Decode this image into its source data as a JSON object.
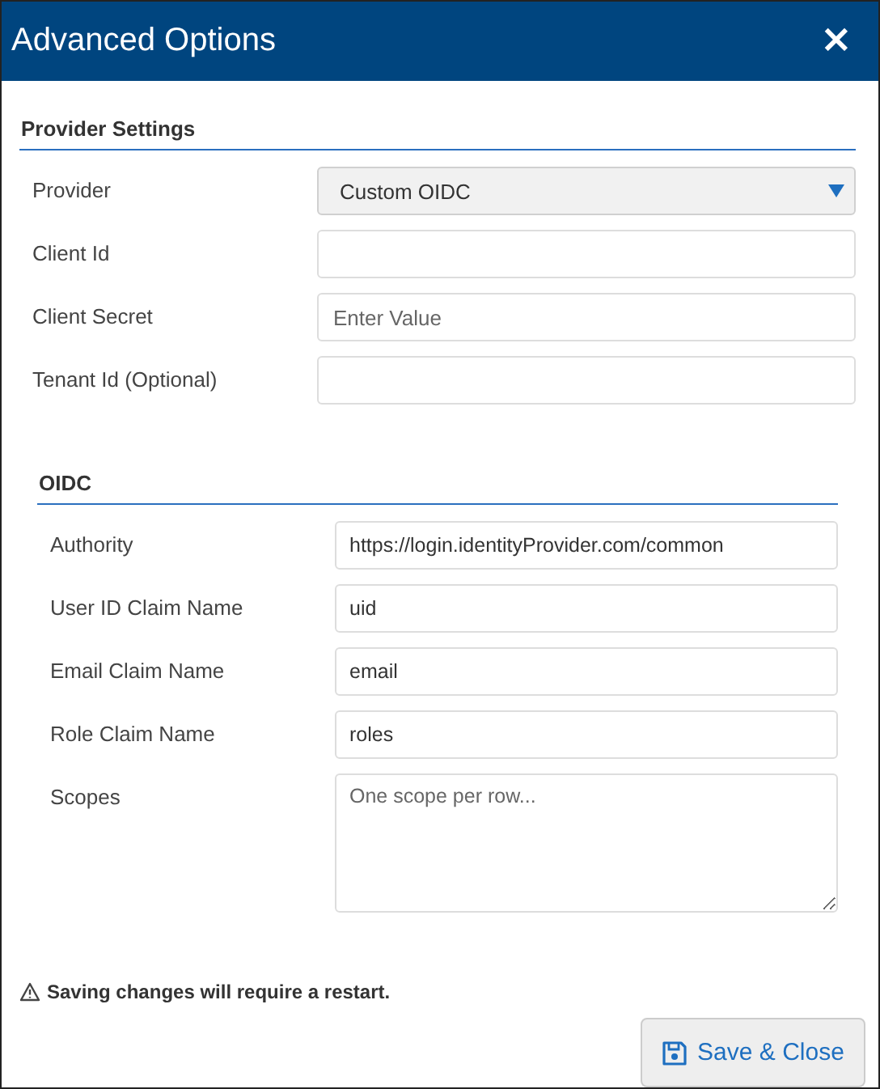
{
  "window": {
    "title": "Advanced Options",
    "close": "×"
  },
  "sections": [
    {
      "title": "Provider Settings",
      "fields": [
        {
          "label": "Provider",
          "kind": "select",
          "value": "Custom OIDC"
        },
        {
          "label": "Client Id",
          "kind": "text"
        },
        {
          "label": "Client Secret",
          "kind": "text",
          "placeholder": "Enter Value"
        },
        {
          "label": "Tenant Id (Optional)",
          "kind": "text"
        }
      ]
    },
    {
      "title": "OIDC",
      "fields": [
        {
          "label": "Authority",
          "kind": "text",
          "value": "https://login.identityProvider.com/common"
        },
        {
          "label": "User ID Claim Name",
          "kind": "text",
          "value": "uid"
        },
        {
          "label": "Email Claim Name",
          "kind": "text",
          "value": "email"
        },
        {
          "label": "Role Claim Name",
          "kind": "text",
          "value": "roles"
        },
        {
          "label": "Scopes",
          "kind": "textarea",
          "placeholder": "One scope per row..."
        }
      ]
    }
  ],
  "warning": "Saving changes will require a restart.",
  "buttons": [
    {
      "label": "Save & Close"
    }
  ]
}
